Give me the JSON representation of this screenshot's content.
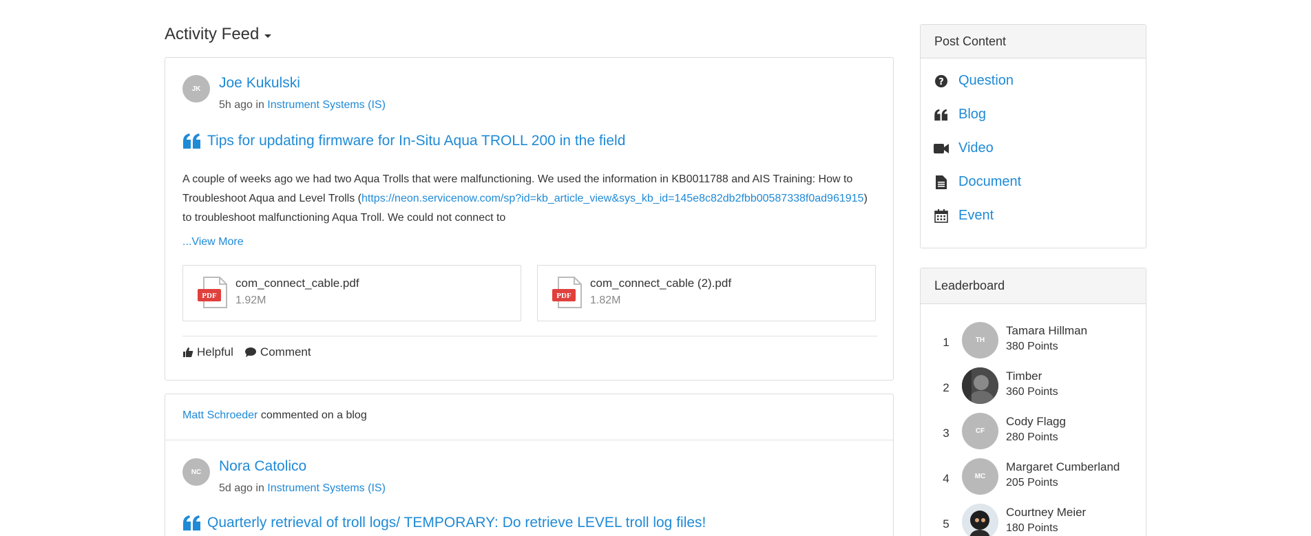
{
  "feed": {
    "header": "Activity Feed"
  },
  "post1": {
    "author_initials": "JK",
    "author_name": "Joe Kukulski",
    "time_ago": "5h ago in",
    "group": "Instrument Systems (IS)",
    "title": "Tips for updating firmware for In-Situ Aqua TROLL 200 in the field",
    "body_part1": "A couple of weeks ago we had two Aqua Trolls that were malfunctioning. We used the information in KB0011788 and AIS Training: How to Troubleshoot Aqua and Level Trolls (",
    "body_link": "https://neon.servicenow.com/sp?id=kb_article_view&sys_kb_id=145e8c82db2fbb00587338f0ad961915",
    "body_part2": ") to troubleshoot malfunctioning Aqua Troll. We could not connect to",
    "view_more": "...View More",
    "attachments": [
      {
        "name": "com_connect_cable.pdf",
        "size": "1.92M",
        "icon": "pdf-file-icon"
      },
      {
        "name": "com_connect_cable (2).pdf",
        "size": "1.82M",
        "icon": "pdf-file-icon"
      }
    ],
    "helpful_label": "Helpful",
    "comment_label": "Comment"
  },
  "post2": {
    "commenter": "Matt Schroeder",
    "activity_text": " commented on a blog",
    "author_initials": "NC",
    "author_name": "Nora Catolico",
    "time_ago": "5d ago in",
    "group": "Instrument Systems (IS)",
    "title": "Quarterly retrieval of troll logs/ TEMPORARY: Do retrieve LEVEL troll log files!"
  },
  "post_content": {
    "title": "Post Content",
    "items": [
      {
        "label": "Question",
        "icon": "question-circle-icon"
      },
      {
        "label": "Blog",
        "icon": "quote-icon"
      },
      {
        "label": "Video",
        "icon": "video-camera-icon"
      },
      {
        "label": "Document",
        "icon": "document-icon"
      },
      {
        "label": "Event",
        "icon": "calendar-icon"
      }
    ]
  },
  "leaderboard": {
    "title": "Leaderboard",
    "rows": [
      {
        "rank": "1",
        "initials": "TH",
        "name": "Tamara Hillman",
        "points": "380 Points"
      },
      {
        "rank": "2",
        "initials": "",
        "name": "Timber",
        "points": "360 Points"
      },
      {
        "rank": "3",
        "initials": "CF",
        "name": "Cody Flagg",
        "points": "280 Points"
      },
      {
        "rank": "4",
        "initials": "MC",
        "name": "Margaret Cumberland",
        "points": "205 Points"
      },
      {
        "rank": "5",
        "initials": "",
        "name": "Courtney Meier",
        "points": "180 Points"
      }
    ]
  },
  "colors": {
    "link": "#1f8ad6",
    "pdf_red": "#e0403c",
    "avatar_gray": "#b9b9b9"
  }
}
